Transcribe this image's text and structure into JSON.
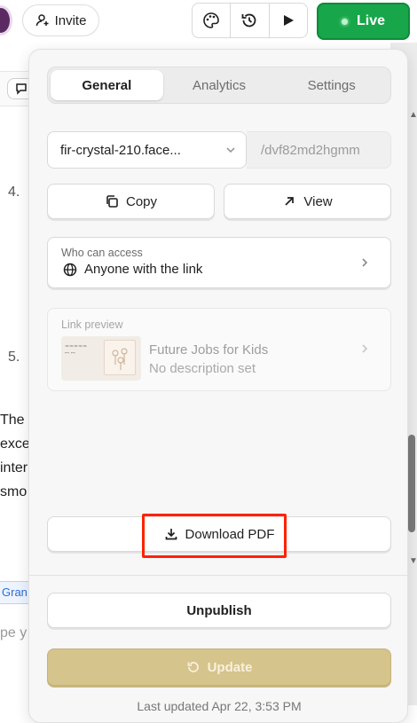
{
  "topbar": {
    "invite_label": "Invite",
    "live_label": "Live",
    "accent_color": "#17a64a"
  },
  "background_doc": {
    "numbers": [
      "4.",
      "5."
    ],
    "lines": [
      "The",
      "exce",
      "inter",
      "smo"
    ],
    "tab_label": "Gran",
    "placeholder": "pe y"
  },
  "panel": {
    "tabs": [
      {
        "label": "General",
        "active": true
      },
      {
        "label": "Analytics",
        "active": false
      },
      {
        "label": "Settings",
        "active": false
      }
    ],
    "url": {
      "subdomain": "fir-crystal-210.face...",
      "path": "/dvf82md2hgmm"
    },
    "copy_label": "Copy",
    "view_label": "View",
    "access": {
      "label": "Who can access",
      "value": "Anyone with the link"
    },
    "preview": {
      "label": "Link preview",
      "title": "Future Jobs for Kids",
      "description": "No description set"
    },
    "download_label": "Download PDF",
    "unpublish_label": "Unpublish",
    "update_label": "Update",
    "last_updated": "Last updated Apr 22, 3:53 PM"
  }
}
